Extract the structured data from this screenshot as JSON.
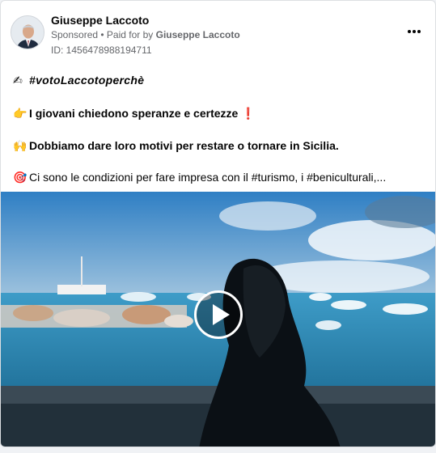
{
  "post": {
    "author": "Giuseppe Laccoto",
    "sponsored_label": "Sponsored",
    "separator": " • ",
    "paid_for_prefix": "Paid for by ",
    "paid_for_name": "Giuseppe Laccoto",
    "id_line": "ID: 1456478988194711",
    "more_icon": "more-horizontal-icon"
  },
  "body": {
    "hashtag_emoji": "✍",
    "hashtag": "#votoLaccotoperchè",
    "line2_emoji": "👉",
    "line2": "I giovani chiedono speranze e certezze",
    "line2_mark": "❗",
    "line3_emoji": "🙌",
    "line3": "Dobbiamo dare loro motivi per restare o tornare in Sicilia",
    "line3_end": ".",
    "line4_emoji": "🎯",
    "line4": "Ci sono le condizioni per fare impresa con il #turismo, i #beniculturali,..."
  },
  "video": {
    "play_icon": "play-icon"
  }
}
